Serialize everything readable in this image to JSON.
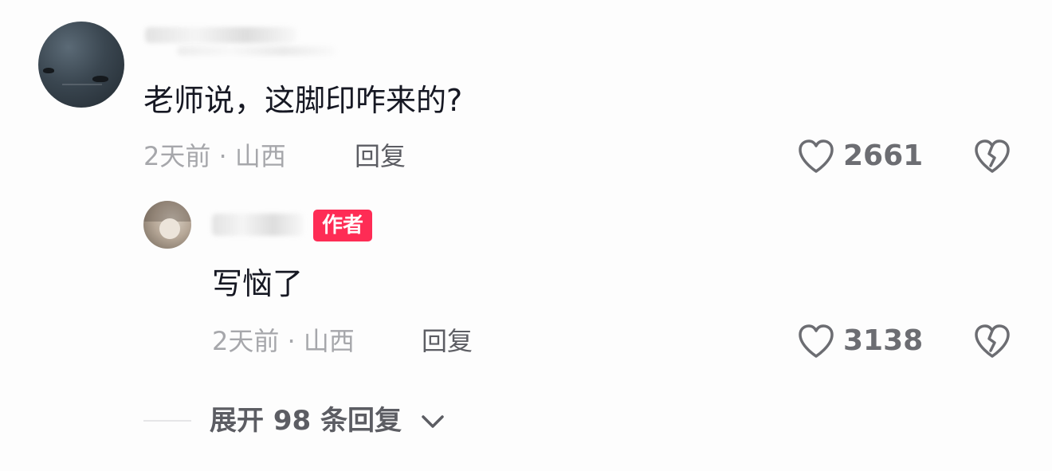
{
  "comment": {
    "text": "老师说，这脚印咋来的?",
    "time": "2天前",
    "separator": "·",
    "location": "山西",
    "reply_label": "回复",
    "like_count": "2661"
  },
  "reply": {
    "author_badge": "作者",
    "text": "写恼了",
    "time": "2天前",
    "separator": "·",
    "location": "山西",
    "reply_label": "回复",
    "like_count": "3138"
  },
  "expand": {
    "label": "展开 98 条回复"
  },
  "colors": {
    "accent": "#fe2c55",
    "text_primary": "#161823",
    "text_meta": "#a6a7ab",
    "icon": "#6c6d72"
  },
  "icons": [
    "heart-icon",
    "broken-heart-icon",
    "chevron-down-icon"
  ]
}
